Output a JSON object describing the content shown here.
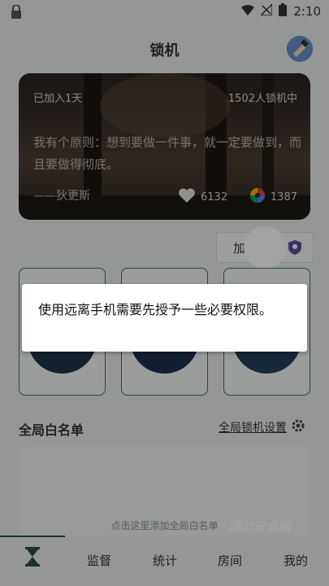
{
  "status_bar": {
    "time": "2:10"
  },
  "header": {
    "title": "锁机"
  },
  "quote_card": {
    "joined_text": "已加入1天",
    "locked_count_text": "1502人锁机中",
    "quote": "我有个原则：想到要做一件事，就一定要做到，而且要做得彻底。",
    "author": "——狄更斯",
    "likes": "6132",
    "shares": "1387"
  },
  "add_room": {
    "label": "加"
  },
  "dialog": {
    "message": "使用远离手机需要先授予一些必要权限。"
  },
  "whitelist": {
    "title": "全局白名单",
    "settings_label": "全局锁机设置",
    "hint": "点击这里添加全局白名单"
  },
  "watermark": "趣动安卓网",
  "bottom_nav": {
    "tabs": [
      {
        "label": ""
      },
      {
        "label": "监督"
      },
      {
        "label": "统计"
      },
      {
        "label": "房间"
      },
      {
        "label": "我的"
      }
    ]
  },
  "colors": {
    "accent": "#3c6e6a",
    "overlay": "rgba(0,0,0,0.36)"
  }
}
